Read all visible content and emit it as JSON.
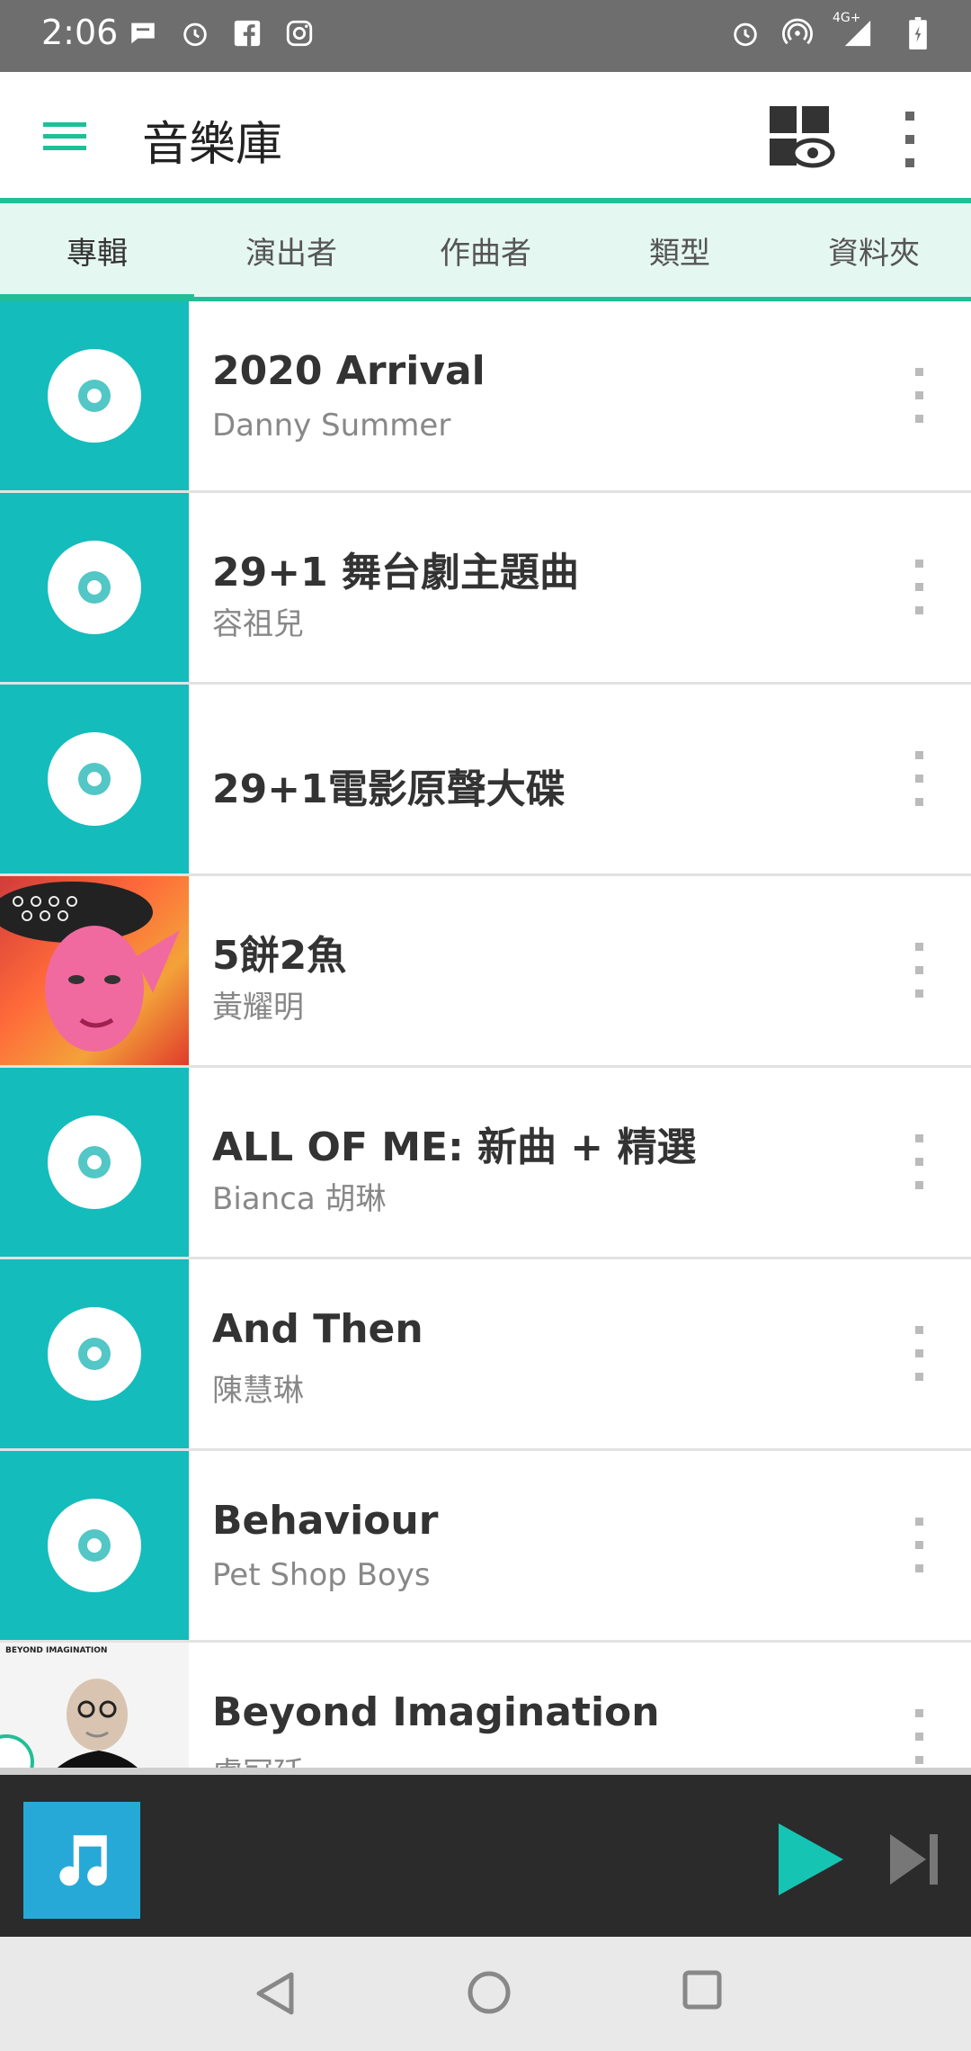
{
  "status_bar": {
    "time": "2:06",
    "left_icons": [
      "message-icon",
      "alarm-icon",
      "facebook-icon",
      "instagram-icon"
    ],
    "right_icons": [
      "alarm-icon",
      "hotspot-icon",
      "signal-icon",
      "battery-icon"
    ],
    "network": "4G+"
  },
  "app_bar": {
    "title": "音樂庫",
    "menu_icon": "hamburger-menu-icon",
    "gallery_icon": "gallery-view-icon",
    "overflow_icon": "more-vert-icon"
  },
  "tabs": [
    {
      "label": "專輯",
      "active": true
    },
    {
      "label": "演出者",
      "active": false
    },
    {
      "label": "作曲者",
      "active": false
    },
    {
      "label": "類型",
      "active": false
    },
    {
      "label": "資料夾",
      "active": false
    }
  ],
  "albums": [
    {
      "title": "2020 Arrival",
      "artist": "Danny Summer",
      "art": "disc"
    },
    {
      "title": "29+1 舞台劇主題曲",
      "artist": "容祖兒",
      "art": "disc"
    },
    {
      "title": "29+1電影原聲大碟",
      "artist": "",
      "art": "disc"
    },
    {
      "title": "5餅2魚",
      "artist": "黃耀明",
      "art": "photo"
    },
    {
      "title": "ALL OF ME: 新曲 + 精選",
      "artist": "Bianca 胡琳",
      "art": "disc"
    },
    {
      "title": "And Then",
      "artist": "陳慧琳",
      "art": "disc"
    },
    {
      "title": "Behaviour",
      "artist": "Pet Shop Boys",
      "art": "disc"
    },
    {
      "title": "Beyond Imagination",
      "artist": "盧冠廷",
      "art": "photo",
      "art_text": "BEYOND IMAGINATION"
    }
  ],
  "player": {
    "art_icon": "music-note-icon",
    "play_icon": "play-icon",
    "next_icon": "skip-next-icon"
  },
  "colors": {
    "accent": "#20bf98",
    "disc_bg": "#14bcbc",
    "player_bg": "#2b2b2b",
    "player_art": "#27a9d8"
  }
}
